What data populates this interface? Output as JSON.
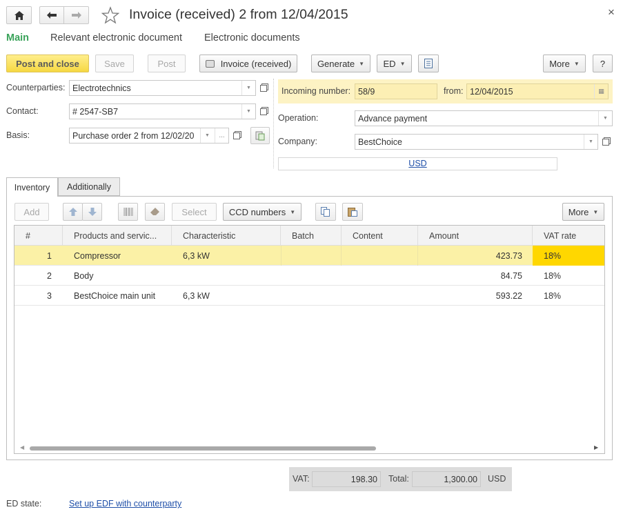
{
  "window": {
    "title": "Invoice (received) 2 from 12/04/2015",
    "close_glyph": "×"
  },
  "nav_tabs": [
    {
      "label": "Main",
      "active": true
    },
    {
      "label": "Relevant electronic document",
      "active": false
    },
    {
      "label": "Electronic documents",
      "active": false
    }
  ],
  "toolbar": {
    "post_close": "Post and close",
    "save": "Save",
    "post": "Post",
    "print_invoice": "Invoice (received)",
    "generate": "Generate",
    "ed": "ED",
    "more": "More",
    "help": "?"
  },
  "form": {
    "counterparties_label": "Counterparties:",
    "counterparties_value": "Electrotechnics",
    "contact_label": "Contact:",
    "contact_value": "# 2547-SB7",
    "basis_label": "Basis:",
    "basis_value": "Purchase order 2 from 12/02/20",
    "basis_ellipsis": "...",
    "incoming_label": "Incoming number:",
    "incoming_value": "58/9",
    "from_label": "from:",
    "from_value": "12/04/2015",
    "operation_label": "Operation:",
    "operation_value": "Advance payment",
    "company_label": "Company:",
    "company_value": "BestChoice",
    "currency_link": "USD"
  },
  "inner_tabs": [
    {
      "label": "Inventory",
      "active": true
    },
    {
      "label": "Additionally",
      "active": false
    }
  ],
  "table_toolbar": {
    "add": "Add",
    "select": "Select",
    "ccd_numbers": "CCD numbers",
    "more": "More"
  },
  "table": {
    "columns": [
      "#",
      "Products and servic...",
      "Characteristic",
      "Batch",
      "Content",
      "Amount",
      "VAT rate"
    ],
    "rows": [
      {
        "n": "1",
        "product": "Compressor",
        "characteristic": "6,3 kW",
        "batch": "",
        "content": "",
        "amount": "423.73",
        "vat_rate": "18%"
      },
      {
        "n": "2",
        "product": "Body",
        "characteristic": "",
        "batch": "",
        "content": "",
        "amount": "84.75",
        "vat_rate": "18%"
      },
      {
        "n": "3",
        "product": "BestChoice main unit",
        "characteristic": "6,3 kW",
        "batch": "",
        "content": "",
        "amount": "593.22",
        "vat_rate": "18%"
      }
    ]
  },
  "totals": {
    "vat_label": "VAT:",
    "vat_value": "198.30",
    "total_label": "Total:",
    "total_value": "1,300.00",
    "currency": "USD"
  },
  "footer": {
    "ed_state_label": "ED state:",
    "ed_state_link": "Set up EDF with counterparty"
  },
  "colors": {
    "accent_green": "#3aa35a",
    "primary_yellow": "#f6d842",
    "selected_row": "#fbf1a6",
    "vat_cell": "#ffd700",
    "link_blue": "#1f4fa8"
  }
}
